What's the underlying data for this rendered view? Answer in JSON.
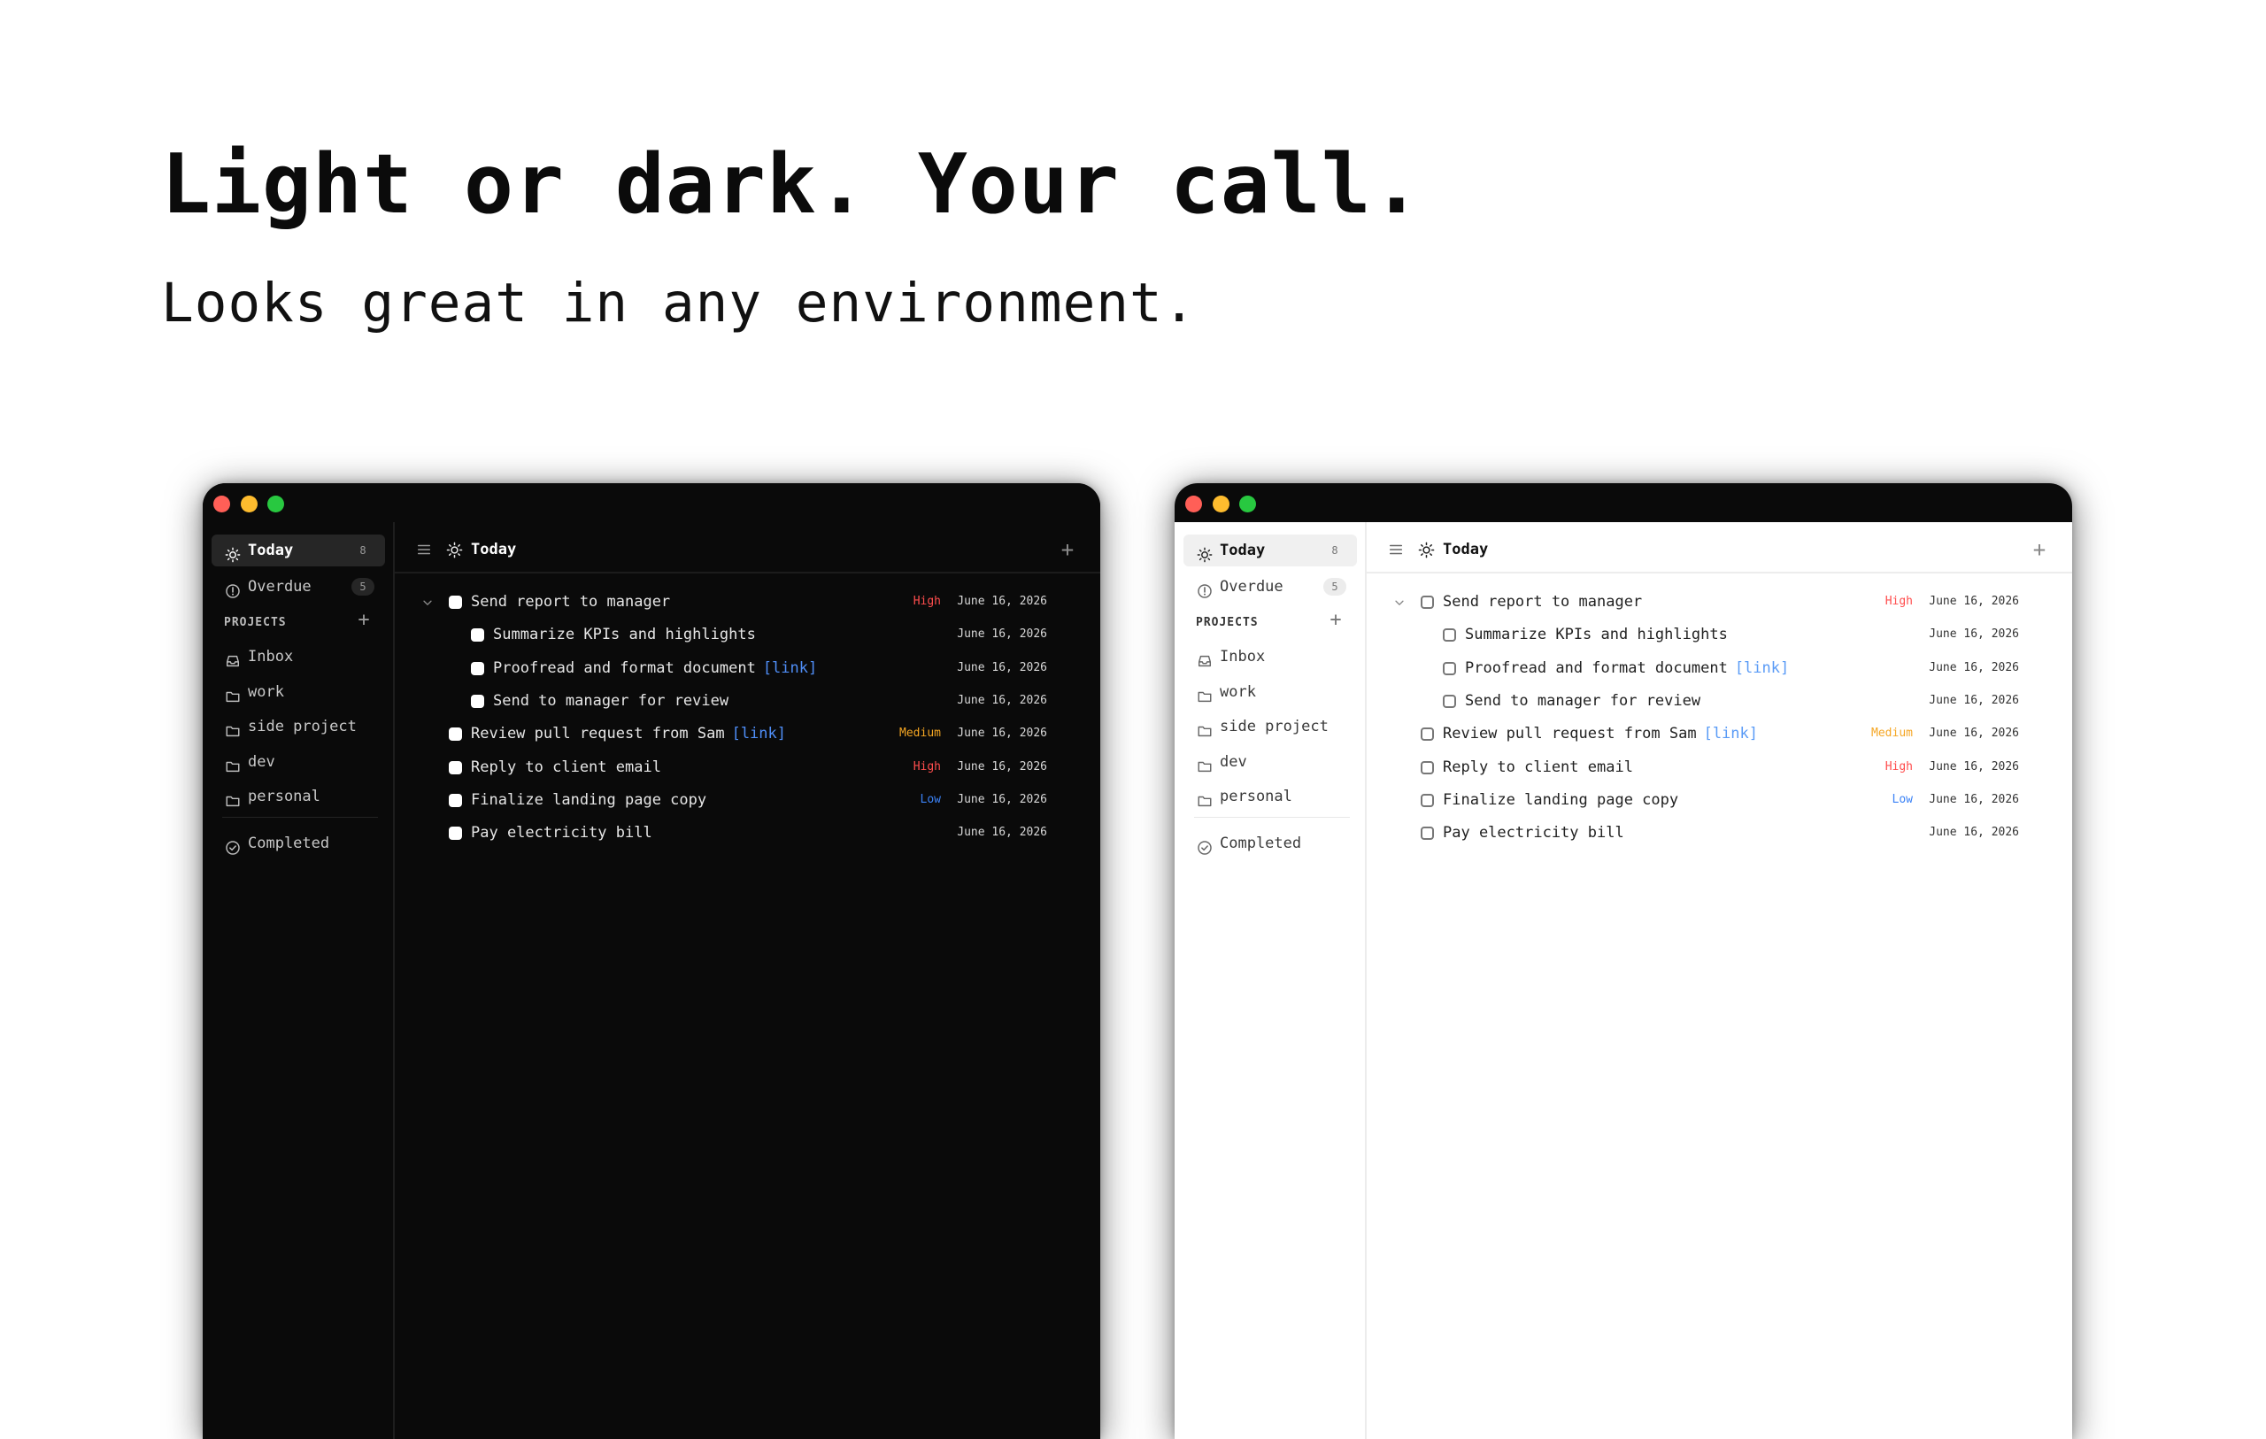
{
  "hero": {
    "headline": "Light or dark. Your call.",
    "subline": "Looks great in any environment."
  },
  "theme_colors": {
    "dark_bg": "#0a0a0a",
    "light_bg": "#ffffff",
    "priority_high": "#ff4d4d",
    "priority_medium": "#f5a623",
    "priority_low": "#3b82f6",
    "link": "#4f8ef7"
  },
  "sidebar": {
    "today": {
      "label": "Today",
      "count": "8",
      "icon": "sun-icon"
    },
    "overdue": {
      "label": "Overdue",
      "count": "5",
      "icon": "alert-circle-icon"
    },
    "projects_label": "PROJECTS",
    "projects_add": "+",
    "projects": [
      {
        "label": "Inbox",
        "icon": "inbox-icon"
      },
      {
        "label": "work",
        "icon": "folder-icon"
      },
      {
        "label": "side project",
        "icon": "folder-icon"
      },
      {
        "label": "dev",
        "icon": "folder-icon"
      },
      {
        "label": "personal",
        "icon": "folder-icon"
      }
    ],
    "completed": {
      "label": "Completed",
      "icon": "check-circle-icon"
    }
  },
  "main": {
    "title": "Today",
    "add": "+",
    "tasks": [
      {
        "title": "Send report to manager",
        "link": "",
        "priority": "High",
        "priority_level": "high",
        "date": "June 16, 2026",
        "subtask": false,
        "has_children": true
      },
      {
        "title": "Summarize KPIs and highlights",
        "link": "",
        "priority": "",
        "priority_level": "",
        "date": "June 16, 2026",
        "subtask": true,
        "has_children": false
      },
      {
        "title": "Proofread and format document",
        "link": "[link]",
        "priority": "",
        "priority_level": "",
        "date": "June 16, 2026",
        "subtask": true,
        "has_children": false
      },
      {
        "title": "Send to manager for review",
        "link": "",
        "priority": "",
        "priority_level": "",
        "date": "June 16, 2026",
        "subtask": true,
        "has_children": false
      },
      {
        "title": "Review pull request from Sam",
        "link": "[link]",
        "priority": "Medium",
        "priority_level": "medium",
        "date": "June 16, 2026",
        "subtask": false,
        "has_children": false
      },
      {
        "title": "Reply to client email",
        "link": "",
        "priority": "High",
        "priority_level": "high",
        "date": "June 16, 2026",
        "subtask": false,
        "has_children": false
      },
      {
        "title": "Finalize landing page copy",
        "link": "",
        "priority": "Low",
        "priority_level": "low",
        "date": "June 16, 2026",
        "subtask": false,
        "has_children": false
      },
      {
        "title": "Pay electricity bill",
        "link": "",
        "priority": "",
        "priority_level": "",
        "date": "June 16, 2026",
        "subtask": false,
        "has_children": false
      }
    ]
  }
}
